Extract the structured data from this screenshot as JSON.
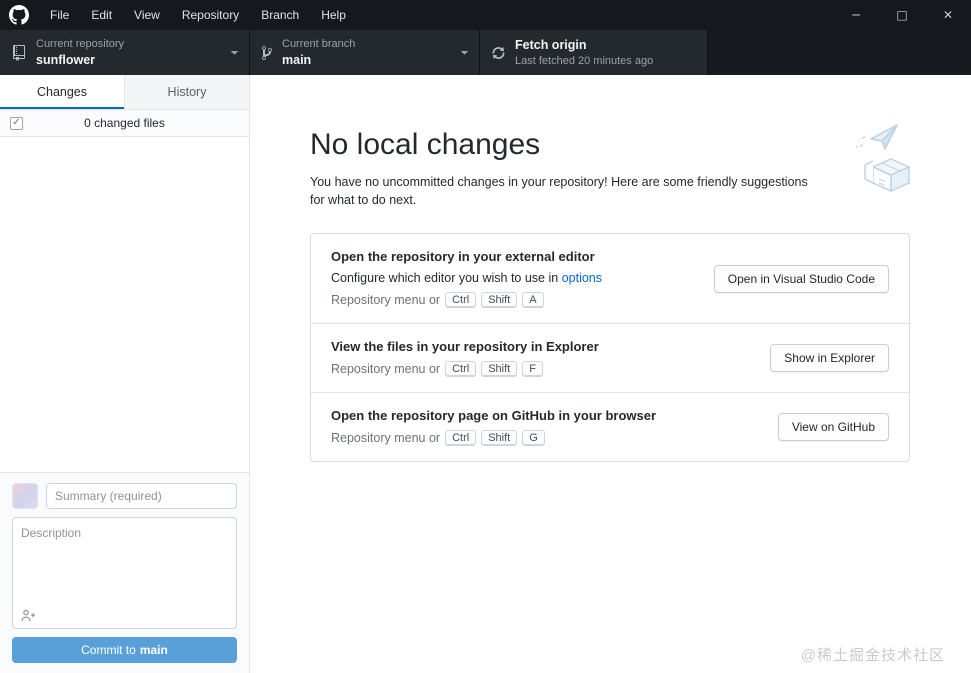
{
  "window": {
    "controls": {
      "minimize": "─",
      "maximize": "□",
      "close": "✕"
    }
  },
  "menu_bar": {
    "items": [
      "File",
      "Edit",
      "View",
      "Repository",
      "Branch",
      "Help"
    ]
  },
  "toolbar": {
    "repository": {
      "label": "Current repository",
      "value": "sunflower"
    },
    "branch": {
      "label": "Current branch",
      "value": "main"
    },
    "fetch": {
      "title": "Fetch origin",
      "subtitle": "Last fetched 20 minutes ago"
    }
  },
  "sidebar": {
    "tabs": [
      {
        "label": "Changes",
        "active": true
      },
      {
        "label": "History",
        "active": false
      }
    ],
    "changed_files": "0 changed files",
    "commit": {
      "summary_placeholder": "Summary (required)",
      "description_placeholder": "Description",
      "button_prefix": "Commit to",
      "button_branch": "main"
    }
  },
  "main": {
    "title": "No local changes",
    "subtitle": "You have no uncommitted changes in your repository! Here are some friendly suggestions for what to do next.",
    "suggestions": [
      {
        "title": "Open the repository in your external editor",
        "subtitle_prefix": "Configure which editor you wish to use in ",
        "subtitle_link": "options",
        "menu_hint": "Repository menu or",
        "keys": [
          "Ctrl",
          "Shift",
          "A"
        ],
        "button": "Open in Visual Studio Code"
      },
      {
        "title": "View the files in your repository in Explorer",
        "menu_hint": "Repository menu or",
        "keys": [
          "Ctrl",
          "Shift",
          "F"
        ],
        "button": "Show in Explorer"
      },
      {
        "title": "Open the repository page on GitHub in your browser",
        "menu_hint": "Repository menu or",
        "keys": [
          "Ctrl",
          "Shift",
          "G"
        ],
        "button": "View on GitHub"
      }
    ],
    "watermark": "@稀土掘金技术社区"
  },
  "colors": {
    "accent": "#0366d6",
    "tab_indicator": "#0366d6",
    "commit_button": "#5aa0d8",
    "toolbar_bg": "#24292e",
    "menubar_bg": "#15191d"
  }
}
